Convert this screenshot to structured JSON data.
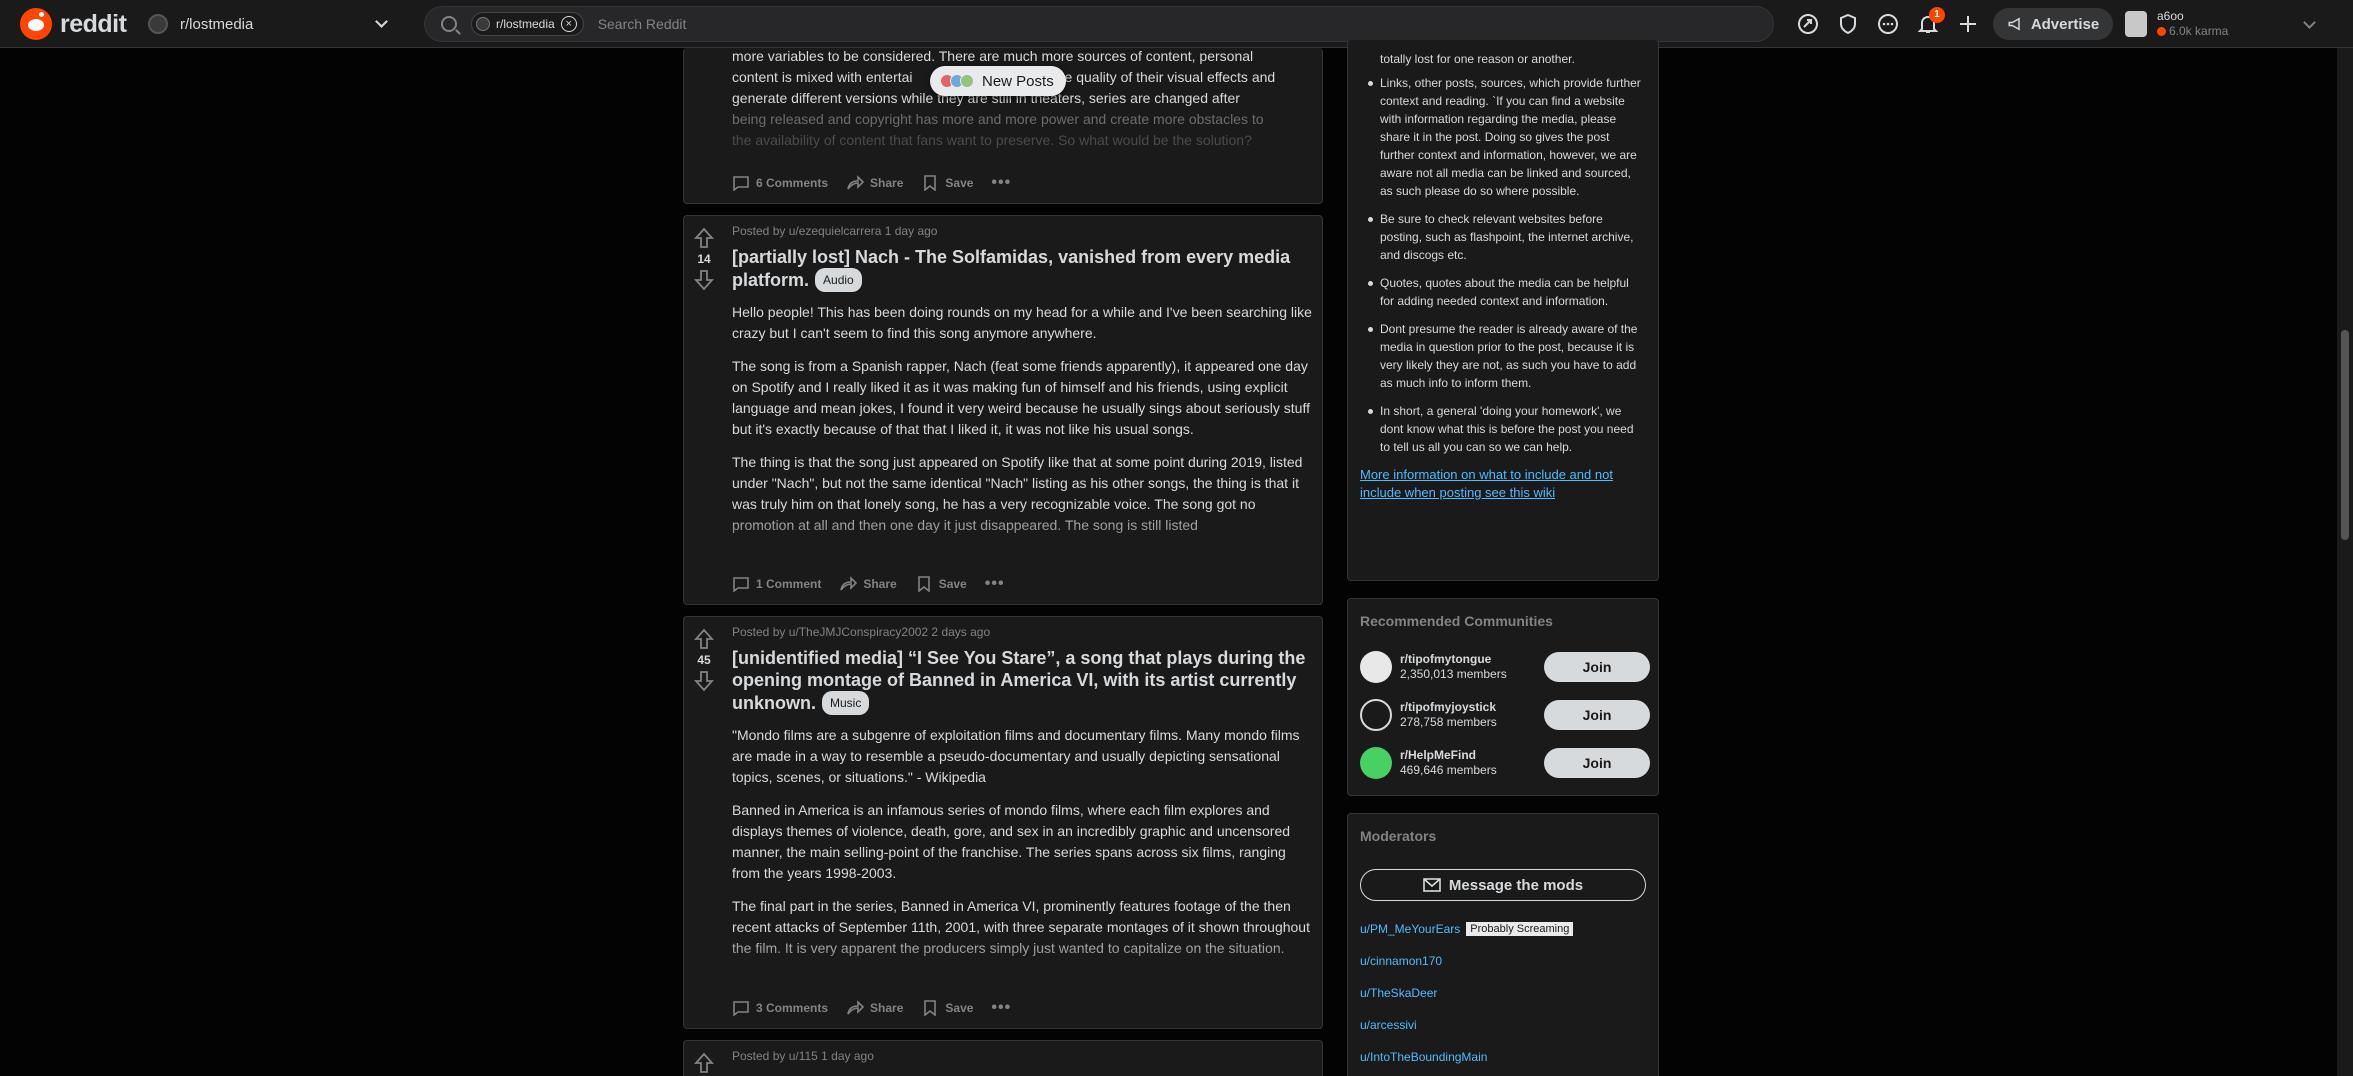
{
  "header": {
    "logo_text": "reddit",
    "community": "r/lostmedia",
    "search": {
      "chip_label": "r/lostmedia",
      "placeholder": "Search Reddit"
    },
    "notification_count": "1",
    "advertise_label": "Advertise",
    "user": {
      "name": "a6oo",
      "karma": "6.0k karma"
    }
  },
  "new_posts_label": "New Posts",
  "posts": [
    {
      "text_lines": [
        "more variables to be considered. There are much more sources of content, personal",
        "content is mixed with entertai",
        "e quality of their visual effects and",
        "generate different versions while they are still in theaters, series are changed after",
        "being released and copyright has more and more power and create more obstacles to",
        "the availability of content that fans want to preserve. So what would be the solution?"
      ],
      "comments": "6 Comments",
      "share": "Share",
      "save": "Save"
    },
    {
      "votes": "14",
      "meta": "Posted by u/ezequielcarrera 1 day ago",
      "title": "[partially lost] Nach - The Solfamidas, vanished from every media platform.",
      "flair": "Audio",
      "paragraphs": [
        "Hello people! This has been doing rounds on my head for a while and I've been searching like crazy but I can't seem to find this song anymore anywhere.",
        "The song is from a Spanish rapper, Nach (feat some friends apparently), it appeared one day on Spotify and I really liked it as it was making fun of himself and his friends, using explicit language and mean jokes, I found it very weird because he usually sings about seriously stuff but it's exactly because of that that I liked it, it was not like his usual songs.",
        "The thing is that the song just appeared on Spotify like that at some point during 2019, listed under \"Nach\", but not the same identical \"Nach\" listing as his other songs, the thing is that it was truly him on that lonely song, he has a very recognizable voice. The song got no promotion at all and then one day it just disappeared. The song is still listed"
      ],
      "comments": "1 Comment",
      "share": "Share",
      "save": "Save"
    },
    {
      "votes": "45",
      "meta": "Posted by u/TheJMJConspiracy2002 2 days ago",
      "title": "[unidentified media] “I See You Stare”, a song that plays during the opening montage of Banned in America VI, with its artist currently unknown.",
      "flair": "Music",
      "paragraphs": [
        "\"Mondo films are a subgenre of exploitation films and documentary films. Many mondo films are made in a way to resemble a pseudo-documentary and usually depicting sensational topics, scenes, or situations.\" - Wikipedia",
        "Banned in America is an infamous series of mondo films, where each film explores and displays themes of violence, death, gore, and sex in an incredibly graphic and uncensored manner, the main selling-point of the franchise. The series spans across six films, ranging from the years 1998-2003.",
        "The final part in the series, Banned in America VI, prominently features footage of the then recent attacks of September 11th, 2001, with three separate montages of it shown throughout the film. It is very apparent the producers simply just wanted to capitalize on the situation."
      ],
      "comments": "3 Comments",
      "share": "Share",
      "save": "Save"
    },
    {
      "meta": "Posted by u/115 1 day ago"
    }
  ],
  "sidebar": {
    "rules_top_line": "totally lost for one reason or another.",
    "rules": [
      "Links, other posts, sources, which provide further context and reading. `If you can find a website with information regarding the media, please share it in the post. Doing so gives the post further context and information, however, we are aware not all media can be linked and sourced, as such please do so where possible.",
      "Be sure to check relevant websites before posting, such as flashpoint, the internet archive, and discogs etc.",
      "Quotes, quotes about the media can be helpful for adding needed context and information.",
      "Dont presume the reader is already aware of the media in question prior to the post, because it is very likely they are not, as such you have to add as much info to inform them.",
      "In short, a general 'doing your homework', we dont know what this is before the post you need to tell us all you can so we can help."
    ],
    "wiki_link": "More information on what to include and not include when posting see this wiki",
    "recommended_title": "Recommended Communities",
    "recommended": [
      {
        "name": "r/tipofmytongue",
        "members": "2,350,013 members",
        "join": "Join",
        "color": "#e8e8e8"
      },
      {
        "name": "r/tipofmyjoystick",
        "members": "278,758 members",
        "join": "Join",
        "color": "#1a1a1b"
      },
      {
        "name": "r/HelpMeFind",
        "members": "469,646 members",
        "join": "Join",
        "color": "#46d160"
      }
    ],
    "moderators_title": "Moderators",
    "message_mods": "Message the mods",
    "mods": [
      {
        "name": "u/PM_MeYourEars",
        "flair": "Probably Screaming"
      },
      {
        "name": "u/cinnamon170"
      },
      {
        "name": "u/TheSkaDeer"
      },
      {
        "name": "u/arcessivi"
      },
      {
        "name": "u/IntoTheBoundingMain"
      }
    ]
  }
}
